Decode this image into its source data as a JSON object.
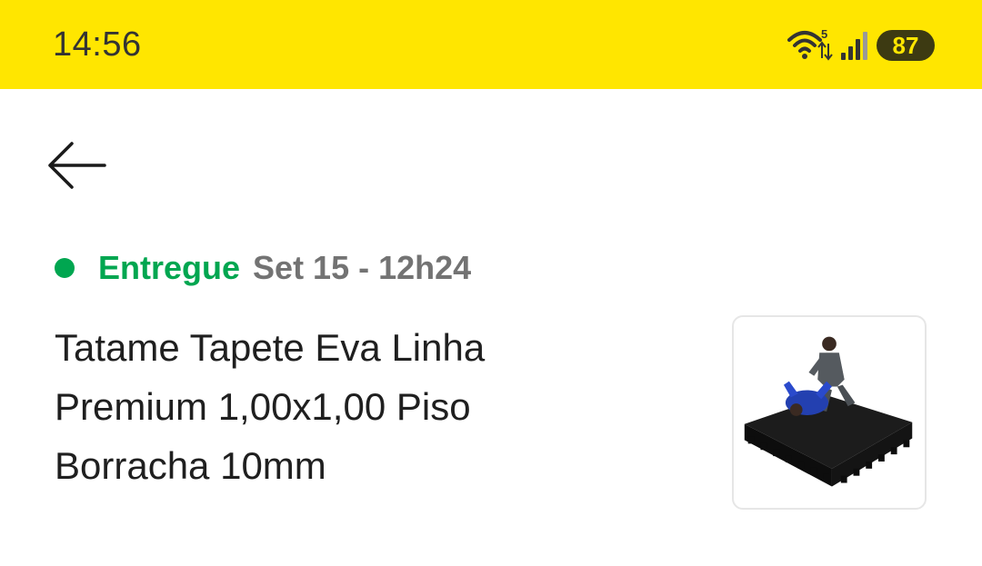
{
  "status_bar": {
    "time": "14:56",
    "wifi_icon": "wifi-5g-icon",
    "signal_icon": "cellular-signal-icon",
    "battery_level": "87",
    "background_color": "#ffe600"
  },
  "header": {
    "back_icon": "arrow-left-icon"
  },
  "order": {
    "status_label": "Entregue",
    "status_color": "#00a650",
    "date": "Set 15 - 12h24",
    "product_title_lines": [
      "Tatame Tapete Eva Linha",
      "Premium 1,00x1,00 Piso",
      "Borracha 10mm"
    ],
    "product_image_icon": "product-thumbnail"
  }
}
